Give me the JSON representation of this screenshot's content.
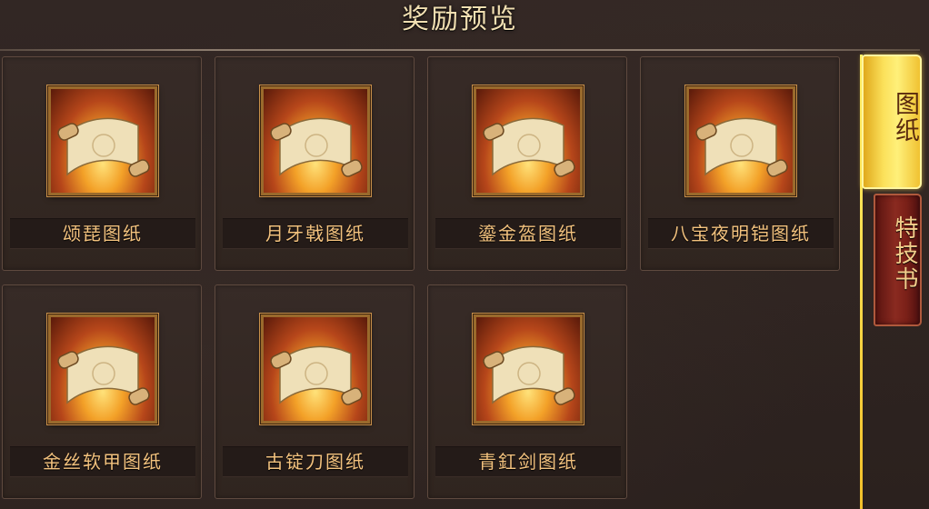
{
  "header": {
    "title": "奖励预览"
  },
  "rewards": [
    {
      "name": "颂琵图纸",
      "icon": "scroll-icon"
    },
    {
      "name": "月牙戟图纸",
      "icon": "scroll-icon"
    },
    {
      "name": "鎏金盔图纸",
      "icon": "scroll-icon"
    },
    {
      "name": "八宝夜明铠图纸",
      "icon": "scroll-icon"
    },
    {
      "name": "金丝软甲图纸",
      "icon": "scroll-icon"
    },
    {
      "name": "古锭刀图纸",
      "icon": "scroll-icon"
    },
    {
      "name": "青釭剑图纸",
      "icon": "scroll-icon"
    }
  ],
  "tabs": [
    {
      "label": "图纸",
      "active": true
    },
    {
      "label": "特技书",
      "active": false
    }
  ],
  "colors": {
    "title": "#f1dfb1",
    "label": "#f3c27e",
    "active_tab": "#fbe05a",
    "inactive_tab": "#8a2a20",
    "card_border": "#5f4a3f"
  }
}
